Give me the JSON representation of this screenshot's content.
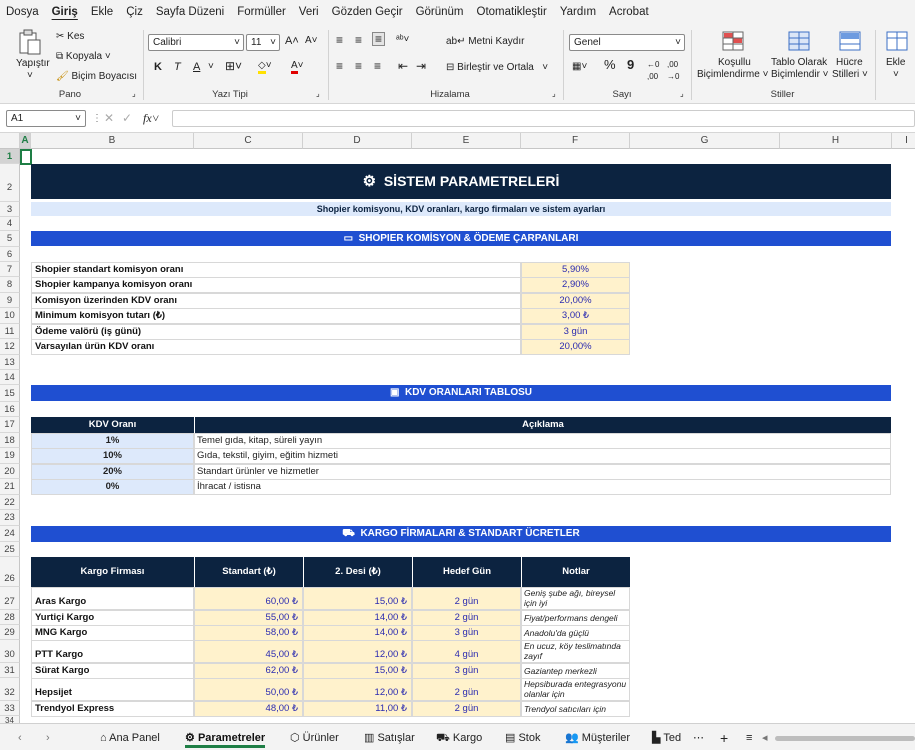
{
  "menu": [
    "Dosya",
    "Giriş",
    "Ekle",
    "Çiz",
    "Sayfa Düzeni",
    "Formüller",
    "Veri",
    "Gözden Geçir",
    "Görünüm",
    "Otomatikleştir",
    "Yardım",
    "Acrobat"
  ],
  "ribbon": {
    "paste": "Yapıştır",
    "cut": "Kes",
    "copy": "Kopyala",
    "format_painter": "Biçim Boyacısı",
    "group_clipboard": "Pano",
    "font_name": "Calibri",
    "font_size": "11",
    "group_font": "Yazı Tipi",
    "wrap_text": "Metni Kaydır",
    "merge_center": "Birleştir ve Ortala",
    "group_alignment": "Hizalama",
    "number_format": "Genel",
    "group_number": "Sayı",
    "cond_format_1": "Koşullu",
    "cond_format_2": "Biçimlendirme ˅",
    "table_format_1": "Tablo Olarak",
    "table_format_2": "Biçimlendir ˅",
    "cell_styles_1": "Hücre",
    "cell_styles_2": "Stilleri ˅",
    "group_styles": "Stiller",
    "insert": "Ekle"
  },
  "formula_bar": {
    "name_box": "A1",
    "fx": "fx",
    "content": ""
  },
  "columns": [
    "A",
    "B",
    "C",
    "D",
    "E",
    "F",
    "G",
    "H",
    "I"
  ],
  "rows": [
    "1",
    "2",
    "3",
    "4",
    "5",
    "6",
    "7",
    "8",
    "9",
    "10",
    "11",
    "12",
    "13",
    "14",
    "15",
    "16",
    "17",
    "18",
    "19",
    "20",
    "21",
    "22",
    "23",
    "24",
    "25",
    "26",
    "27",
    "28",
    "29",
    "30",
    "31",
    "32",
    "33",
    "34"
  ],
  "sheet": {
    "title": "SİSTEM PARAMETRELERİ",
    "subtitle": "Shopier komisyonu, KDV oranları, kargo firmaları ve sistem ayarları",
    "section1": "SHOPIER KOMİSYON & ÖDEME ÇARPANLARI",
    "params": [
      {
        "label": "Shopier standart komisyon oranı",
        "value": "5,90%"
      },
      {
        "label": "Shopier kampanya komisyon oranı",
        "value": "2,90%"
      },
      {
        "label": "Komisyon üzerinden KDV oranı",
        "value": "20,00%"
      },
      {
        "label": "Minimum komisyon tutarı (₺)",
        "value": "3,00 ₺"
      },
      {
        "label": "Ödeme valörü (iş günü)",
        "value": "3  gün"
      },
      {
        "label": "Varsayılan ürün KDV oranı",
        "value": "20,00%"
      }
    ],
    "section2": "KDV ORANLARI TABLOSU",
    "kdv_headers": [
      "KDV Oranı",
      "Açıklama"
    ],
    "kdv_rows": [
      {
        "rate": "1%",
        "desc": "Temel gıda, kitap, süreli yayın"
      },
      {
        "rate": "10%",
        "desc": "Gıda, tekstil, giyim, eğitim hizmeti"
      },
      {
        "rate": "20%",
        "desc": "Standart ürünler ve hizmetler"
      },
      {
        "rate": "0%",
        "desc": "İhracat / istisna"
      }
    ],
    "section3": "KARGO FİRMALARI & STANDART ÜCRETLER",
    "cargo_headers": [
      "Kargo Firması",
      "Standart (₺)",
      "2. Desi (₺)",
      "Hedef Gün",
      "Notlar"
    ],
    "cargo_rows": [
      {
        "name": "Aras Kargo",
        "std": "60,00 ₺",
        "desi": "15,00 ₺",
        "day": "2  gün",
        "note": "Geniş şube ağı, bireysel için iyi"
      },
      {
        "name": "Yurtiçi Kargo",
        "std": "55,00 ₺",
        "desi": "14,00 ₺",
        "day": "2  gün",
        "note": "Fiyat/performans dengeli"
      },
      {
        "name": "MNG Kargo",
        "std": "58,00 ₺",
        "desi": "14,00 ₺",
        "day": "3  gün",
        "note": "Anadolu'da güçlü"
      },
      {
        "name": "PTT Kargo",
        "std": "45,00 ₺",
        "desi": "12,00 ₺",
        "day": "4  gün",
        "note": "En ucuz, köy teslimatında zayıf"
      },
      {
        "name": "Sürat Kargo",
        "std": "62,00 ₺",
        "desi": "15,00 ₺",
        "day": "3  gün",
        "note": "Gaziantep merkezli"
      },
      {
        "name": "Hepsijet",
        "std": "50,00 ₺",
        "desi": "12,00 ₺",
        "day": "2  gün",
        "note": "Hepsiburada entegrasyonu olanlar için"
      },
      {
        "name": "Trendyol Express",
        "std": "48,00 ₺",
        "desi": "11,00 ₺",
        "day": "2  gün",
        "note": "Trendyol satıcıları için"
      }
    ]
  },
  "tabs": [
    "Ana Panel",
    "Parametreler",
    "Ürünler",
    "Satışlar",
    "Kargo",
    "Stok",
    "Müşteriler",
    "Ted"
  ],
  "colors": {
    "navy": "#0c2340",
    "band": "#1f4fd1",
    "yellow": "#fff2cc",
    "light_blue": "#dde9fb",
    "green": "#1e7e45"
  }
}
